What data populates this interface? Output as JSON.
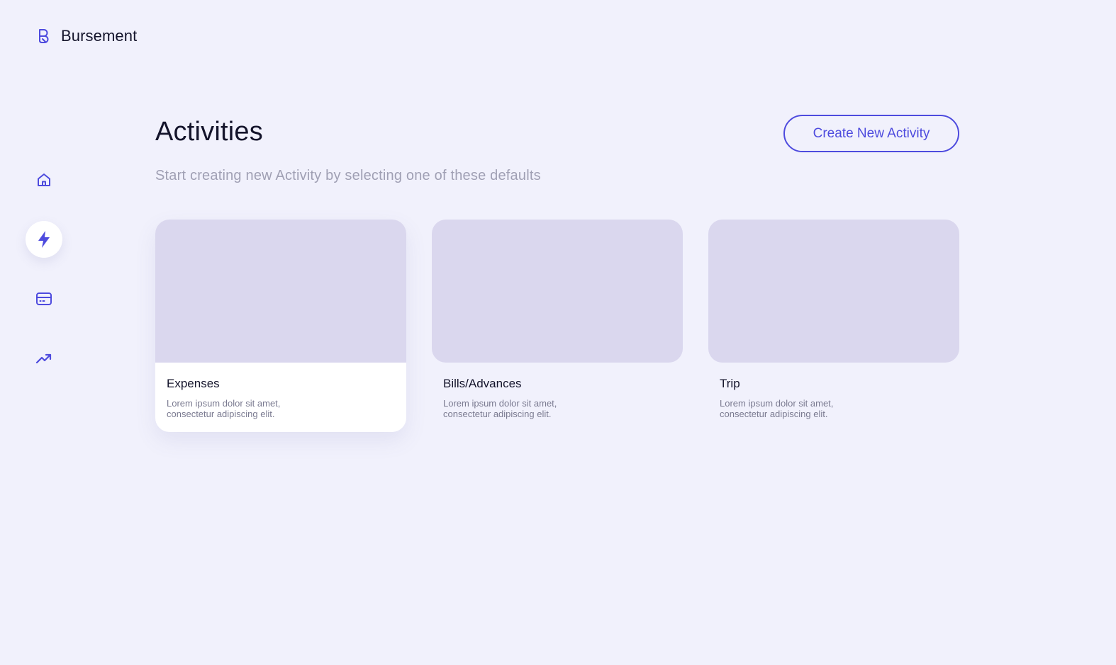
{
  "brand": {
    "name": "Bursement",
    "logo_icon": "b-logo-icon"
  },
  "sidebar": {
    "items": [
      {
        "id": "home",
        "icon": "home-icon",
        "active": false
      },
      {
        "id": "activities",
        "icon": "lightning-icon",
        "active": true
      },
      {
        "id": "cards",
        "icon": "credit-card-icon",
        "active": false
      },
      {
        "id": "analytics",
        "icon": "trending-up-icon",
        "active": false
      }
    ]
  },
  "main": {
    "title": "Activities",
    "subtitle": "Start creating new Activity by selecting one of these defaults",
    "create_button_label": "Create New Activity",
    "cards": [
      {
        "title": "Expenses",
        "description": "Lorem ipsum dolor sit amet, consectetur adipiscing elit.",
        "selected": true
      },
      {
        "title": "Bills/Advances",
        "description": "Lorem ipsum dolor sit amet, consectetur adipiscing elit.",
        "selected": false
      },
      {
        "title": "Trip",
        "description": "Lorem ipsum dolor sit amet, consectetur adipiscing elit.",
        "selected": false
      }
    ]
  },
  "colors": {
    "background": "#f1f1fc",
    "accent": "#4e4bde",
    "card_media": "#dad7ee",
    "text_primary": "#14142b",
    "text_muted": "#a0a0b4"
  }
}
